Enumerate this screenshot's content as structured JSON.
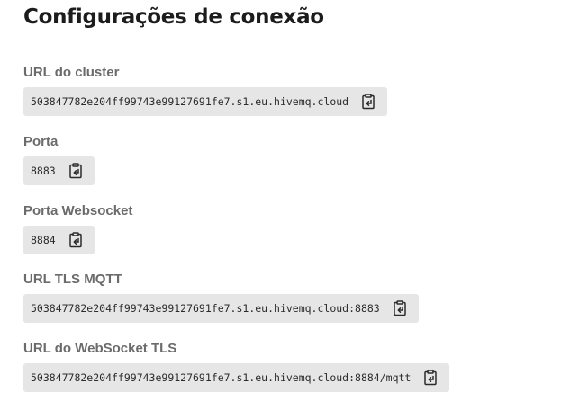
{
  "page": {
    "title": "Configurações de conexão"
  },
  "fields": {
    "cluster_url": {
      "label": "URL do cluster",
      "value": "503847782e204ff99743e99127691fe7.s1.eu.hivemq.cloud",
      "icon": "copy-icon"
    },
    "port": {
      "label": "Porta",
      "value": "8883",
      "icon": "copy-icon"
    },
    "websocket_port": {
      "label": "Porta Websocket",
      "value": "8884",
      "icon": "copy-icon"
    },
    "tls_mqtt_url": {
      "label": "URL TLS MQTT",
      "value": "503847782e204ff99743e99127691fe7.s1.eu.hivemq.cloud:8883",
      "icon": "copy-icon"
    },
    "tls_websocket_url": {
      "label": "URL do WebSocket TLS",
      "value": "503847782e204ff99743e99127691fe7.s1.eu.hivemq.cloud:8884/mqtt",
      "icon": "copy-icon"
    }
  },
  "colors": {
    "title": "#1c1c1c",
    "label": "#6b6b6b",
    "chip_background": "#e6e6e6",
    "value_text": "#2b2b2b",
    "icon": "#2b2b2b"
  }
}
